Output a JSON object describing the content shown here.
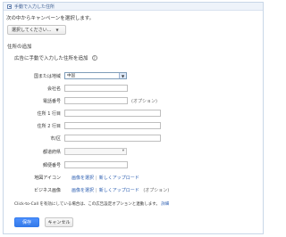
{
  "panel": {
    "title": "手動で入力した住所"
  },
  "intro": "次の中からキャンペーンを選択します。",
  "campaign_select": {
    "label": "選択してください...",
    "caret": "▼"
  },
  "section": {
    "title": "住所の追加",
    "subtitle": "広告に手動で入力した住所を追加",
    "help": "?"
  },
  "form": {
    "country": {
      "label": "国または地域",
      "value": "中国"
    },
    "company": {
      "label": "会社名"
    },
    "phone": {
      "label": "電話番号",
      "optional": "(オプション)"
    },
    "address1": {
      "label": "住所 1 行目"
    },
    "address2": {
      "label": "住所 2 行目"
    },
    "city": {
      "label": "市/区"
    },
    "prefecture": {
      "label": "都道府県"
    },
    "postal": {
      "label": "郵便番号"
    },
    "map_icon": {
      "label": "地図アイコン",
      "choose": "画像を選択",
      "upload": "新しくアップロード"
    },
    "business_image": {
      "label": "ビジネス画像",
      "choose": "画像を選択",
      "upload": "新しくアップロード",
      "optional": "(オプション)"
    }
  },
  "note": {
    "text": "Click-to-Call を有効にしている場合は、この広告設定オプションと連動します。",
    "link": "詳細"
  },
  "buttons": {
    "save": "保存",
    "cancel": "キャンセル"
  },
  "colors": {
    "link": "#2a5db0",
    "primary": "#4d90fe",
    "header_bg": "#eef3fa"
  }
}
